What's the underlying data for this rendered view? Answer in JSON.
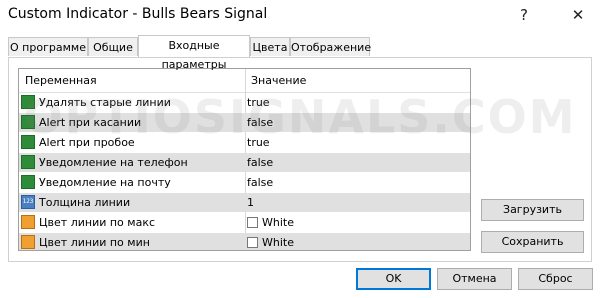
{
  "window": {
    "title": "Custom Indicator - Bulls Bears Signal",
    "help_glyph": "?",
    "close_glyph": "✕"
  },
  "tabs": [
    {
      "label": "О программе"
    },
    {
      "label": "Общие"
    },
    {
      "label": "Входные параметры",
      "active": true
    },
    {
      "label": "Цвета"
    },
    {
      "label": "Отображение"
    }
  ],
  "grid": {
    "col_variable": "Переменная",
    "col_value": "Значение",
    "rows": [
      {
        "name": "Удалять старые линии",
        "value": "true",
        "icon": "bool-param-icon"
      },
      {
        "name": "Alert при касании",
        "value": "false",
        "icon": "bool-param-icon"
      },
      {
        "name": "Alert при пробое",
        "value": "true",
        "icon": "bool-param-icon"
      },
      {
        "name": "Уведомление на телефон",
        "value": "false",
        "icon": "bool-param-icon"
      },
      {
        "name": "Уведомление на почту",
        "value": "false",
        "icon": "bool-param-icon"
      },
      {
        "name": "Толщина линии",
        "value": "1",
        "icon": "int-param-icon"
      },
      {
        "name": "Цвет линии по макс",
        "value": "White",
        "icon": "color-param-icon"
      },
      {
        "name": "Цвет линии по мин",
        "value": "White",
        "icon": "color-param-icon"
      }
    ]
  },
  "side_buttons": {
    "load": "Загрузить",
    "save": "Сохранить"
  },
  "footer_buttons": {
    "ok": "OK",
    "cancel": "Отмена",
    "reset": "Сброс"
  },
  "watermark": "OPTIOSIGNALS.COM"
}
